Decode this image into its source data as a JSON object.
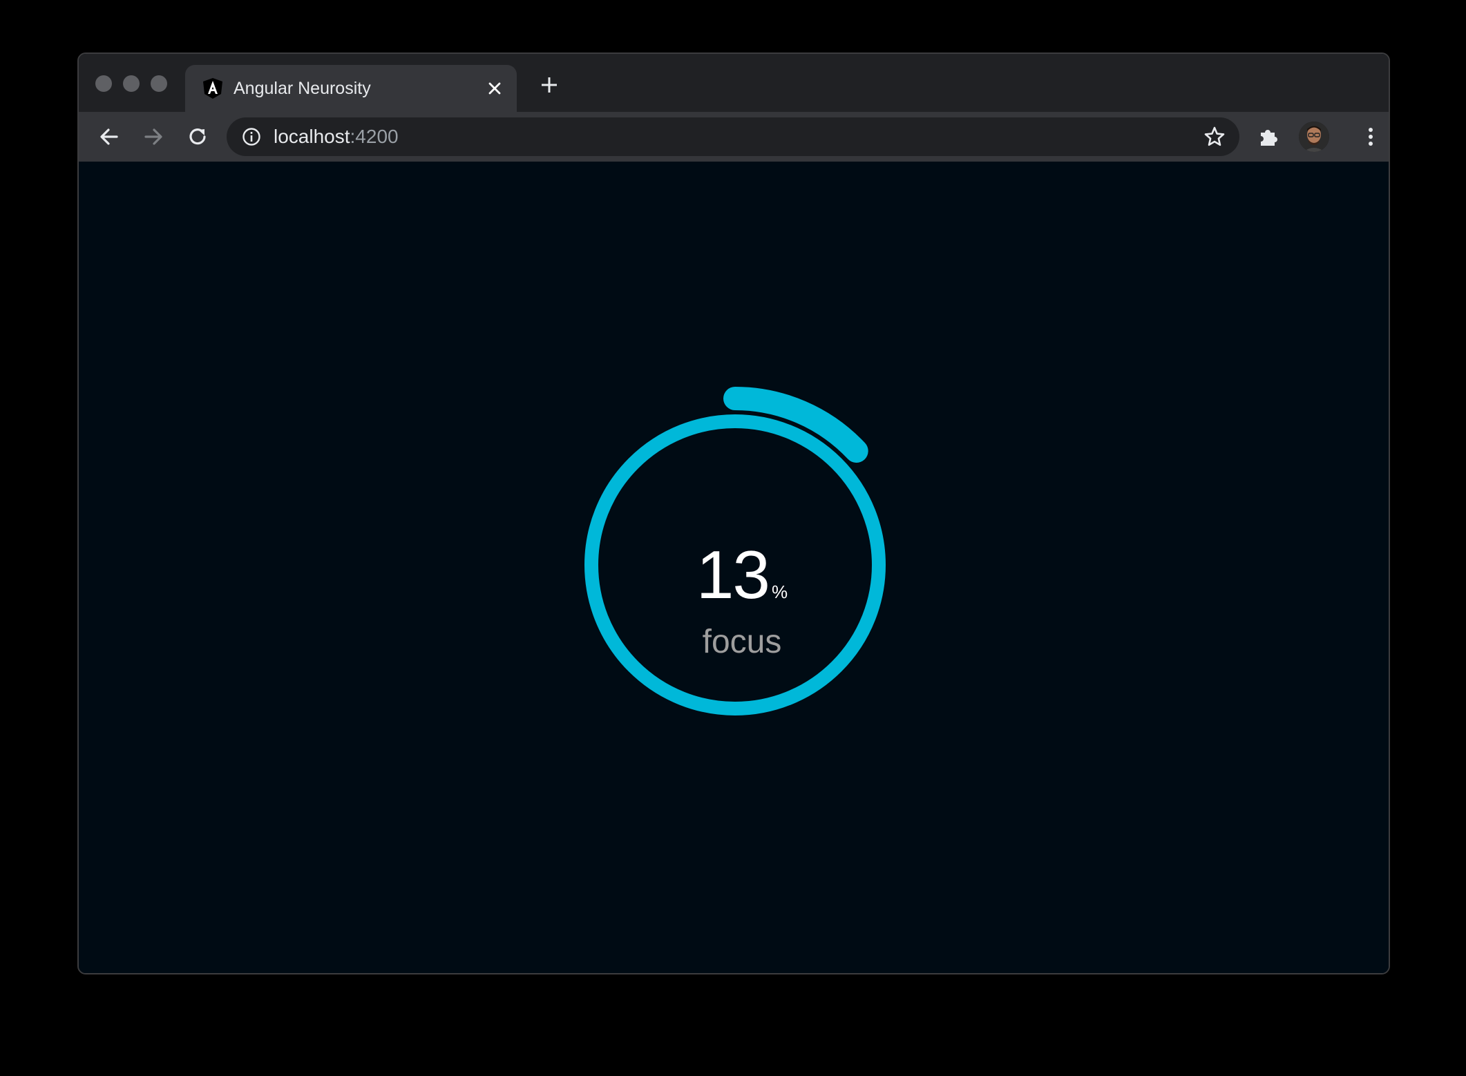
{
  "browser": {
    "tab": {
      "title": "Angular Neurosity",
      "favicon": "angular-icon"
    },
    "omnibox": {
      "host": "localhost",
      "port": ":4200"
    },
    "icons": {
      "back": "arrow-left-icon",
      "forward": "arrow-right-icon",
      "reload": "reload-icon",
      "info": "info-icon",
      "bookmark": "star-icon",
      "extensions": "puzzle-icon",
      "menu": "kebab-menu-icon"
    }
  },
  "gauge": {
    "value": "13",
    "unit": "%",
    "label": "focus",
    "level": 0.13,
    "color": "#00b8d9"
  }
}
